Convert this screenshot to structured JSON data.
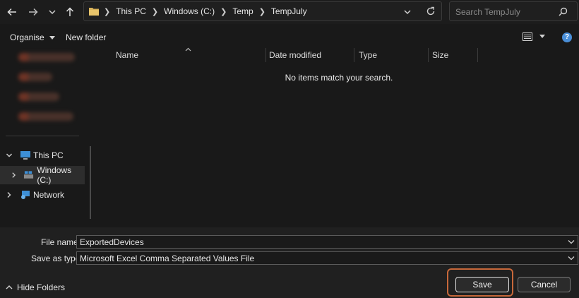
{
  "nav": {
    "back_icon": "arrow-left-icon",
    "forward_icon": "arrow-right-icon",
    "recent_icon": "chevron-down-icon",
    "up_icon": "arrow-up-icon"
  },
  "address": {
    "crumbs": [
      "This PC",
      "Windows (C:)",
      "Temp",
      "TempJuly"
    ]
  },
  "search": {
    "placeholder": "Search TempJuly"
  },
  "commands": {
    "organise": "Organise",
    "new_folder": "New folder"
  },
  "tree": {
    "this_pc": "This PC",
    "windows_c": "Windows (C:)",
    "network": "Network"
  },
  "columns": {
    "name": "Name",
    "date_modified": "Date modified",
    "type": "Type",
    "size": "Size"
  },
  "list": {
    "empty_message": "No items match your search."
  },
  "form": {
    "file_name_label": "File name:",
    "file_name_value": "ExportedDevices",
    "save_type_label": "Save as type:",
    "save_type_value": "Microsoft Excel Comma Separated Values File"
  },
  "footer": {
    "hide_folders": "Hide Folders",
    "save": "Save",
    "cancel": "Cancel"
  },
  "colors": {
    "background": "#191919",
    "accent_focus": "#c8683a",
    "help_icon": "#4a8fd8"
  }
}
